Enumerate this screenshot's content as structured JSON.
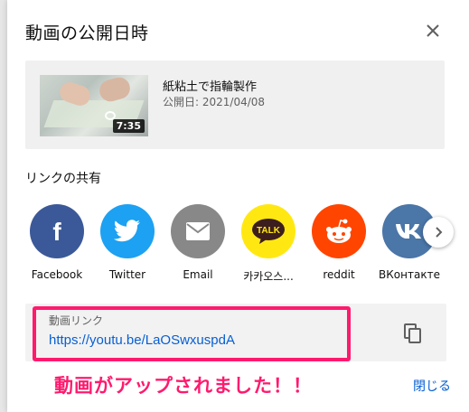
{
  "dialog": {
    "title": "動画の公開日時",
    "close_icon": "close-icon"
  },
  "video": {
    "title": "紙粘土で指輪製作",
    "date": "公開日: 2021/04/08",
    "duration": "7:35"
  },
  "share": {
    "label": "リンクの共有",
    "items": [
      {
        "name": "Facebook",
        "icon": "facebook-icon",
        "color": "#3b5998"
      },
      {
        "name": "Twitter",
        "icon": "twitter-icon",
        "color": "#1da1f2"
      },
      {
        "name": "Email",
        "icon": "email-icon",
        "color": "#888888"
      },
      {
        "name": "카카오스...",
        "icon": "kakaotalk-icon",
        "color": "#ffe812"
      },
      {
        "name": "reddit",
        "icon": "reddit-icon",
        "color": "#ff4500"
      },
      {
        "name": "ВКонтакте",
        "icon": "vk-icon",
        "color": "#4a76a8"
      }
    ],
    "next_icon": "chevron-right-icon"
  },
  "link": {
    "label": "動画リンク",
    "url": "https://youtu.be/LaOSwxuspdA",
    "copy_icon": "copy-icon"
  },
  "annotation": "動画がアップされました！！",
  "close_label": "閉じる",
  "colors": {
    "accent": "#065fd4",
    "highlight": "#ff1a6e"
  }
}
